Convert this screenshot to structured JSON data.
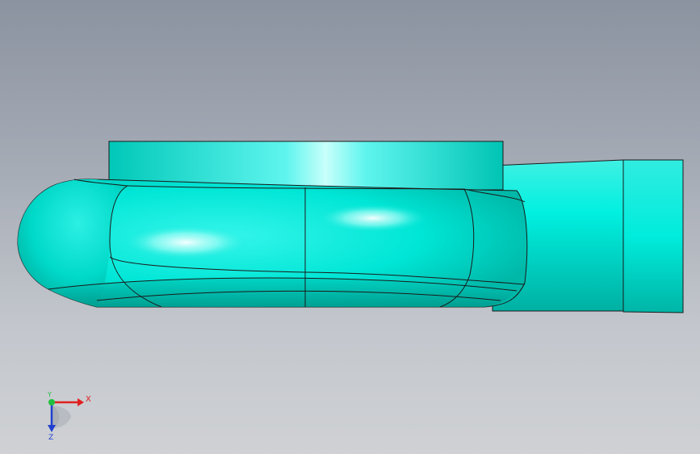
{
  "viewport": {
    "background_top": "#8b93a0",
    "background_bottom": "#cfd1d4"
  },
  "model": {
    "color": "#00e8d8",
    "edge_color": "#1a1a1a"
  },
  "triad": {
    "x_label": "X",
    "y_label": "Y",
    "z_label": "Z",
    "x_color": "#e02020",
    "y_color": "#20c040",
    "z_color": "#2040d0"
  }
}
